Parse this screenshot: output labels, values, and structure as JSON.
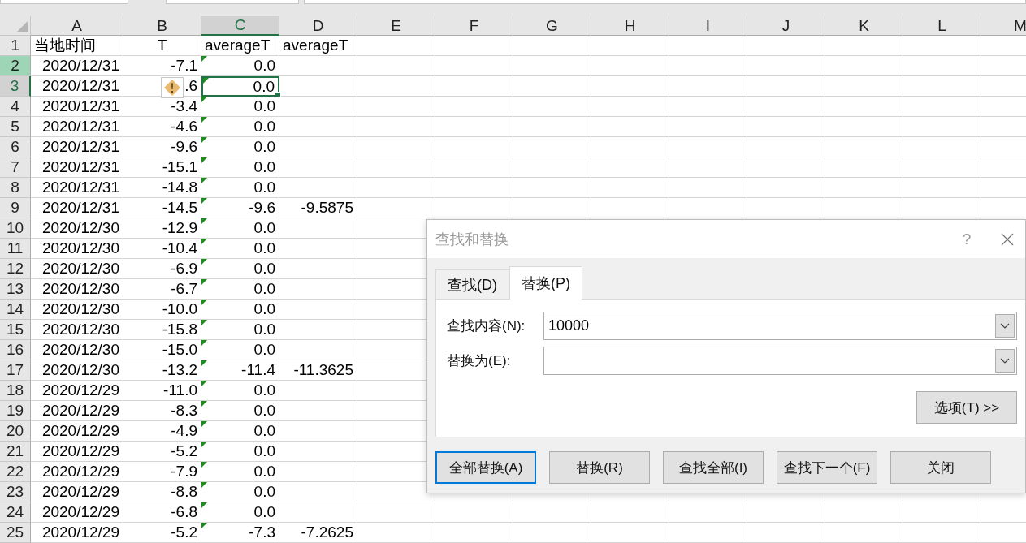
{
  "columns": [
    {
      "label": "A",
      "selected": false
    },
    {
      "label": "B",
      "selected": false
    },
    {
      "label": "C",
      "selected": true
    },
    {
      "label": "D",
      "selected": false
    },
    {
      "label": "E",
      "selected": false
    },
    {
      "label": "F",
      "selected": false
    },
    {
      "label": "G",
      "selected": false
    },
    {
      "label": "H",
      "selected": false
    },
    {
      "label": "I",
      "selected": false
    },
    {
      "label": "J",
      "selected": false
    },
    {
      "label": "K",
      "selected": false
    },
    {
      "label": "L",
      "selected": false
    },
    {
      "label": "M",
      "selected": false
    }
  ],
  "rows": [
    {
      "num": "1",
      "selected": false,
      "highlighted": false,
      "cells": [
        "当地时间",
        "T",
        "averageT",
        "averageT"
      ],
      "flag": false
    },
    {
      "num": "2",
      "selected": false,
      "highlighted": true,
      "cells": [
        "2020/12/31",
        "-7.1",
        "0.0",
        ""
      ],
      "flag": true
    },
    {
      "num": "3",
      "selected": true,
      "highlighted": false,
      "cells": [
        "2020/12/31",
        ".6",
        "0.0",
        ""
      ],
      "flag": true,
      "warning": true
    },
    {
      "num": "4",
      "selected": false,
      "highlighted": false,
      "cells": [
        "2020/12/31",
        "-3.4",
        "0.0",
        ""
      ],
      "flag": true
    },
    {
      "num": "5",
      "selected": false,
      "highlighted": false,
      "cells": [
        "2020/12/31",
        "-4.6",
        "0.0",
        ""
      ],
      "flag": true
    },
    {
      "num": "6",
      "selected": false,
      "highlighted": false,
      "cells": [
        "2020/12/31",
        "-9.6",
        "0.0",
        ""
      ],
      "flag": true
    },
    {
      "num": "7",
      "selected": false,
      "highlighted": false,
      "cells": [
        "2020/12/31",
        "-15.1",
        "0.0",
        ""
      ],
      "flag": true
    },
    {
      "num": "8",
      "selected": false,
      "highlighted": false,
      "cells": [
        "2020/12/31",
        "-14.8",
        "0.0",
        ""
      ],
      "flag": true
    },
    {
      "num": "9",
      "selected": false,
      "highlighted": false,
      "cells": [
        "2020/12/31",
        "-14.5",
        "-9.6",
        "-9.5875"
      ],
      "flag": true
    },
    {
      "num": "10",
      "selected": false,
      "highlighted": false,
      "cells": [
        "2020/12/30",
        "-12.9",
        "0.0",
        ""
      ],
      "flag": true
    },
    {
      "num": "11",
      "selected": false,
      "highlighted": false,
      "cells": [
        "2020/12/30",
        "-10.4",
        "0.0",
        ""
      ],
      "flag": true
    },
    {
      "num": "12",
      "selected": false,
      "highlighted": false,
      "cells": [
        "2020/12/30",
        "-6.9",
        "0.0",
        ""
      ],
      "flag": true
    },
    {
      "num": "13",
      "selected": false,
      "highlighted": false,
      "cells": [
        "2020/12/30",
        "-6.7",
        "0.0",
        ""
      ],
      "flag": true
    },
    {
      "num": "14",
      "selected": false,
      "highlighted": false,
      "cells": [
        "2020/12/30",
        "-10.0",
        "0.0",
        ""
      ],
      "flag": true
    },
    {
      "num": "15",
      "selected": false,
      "highlighted": false,
      "cells": [
        "2020/12/30",
        "-15.8",
        "0.0",
        ""
      ],
      "flag": true
    },
    {
      "num": "16",
      "selected": false,
      "highlighted": false,
      "cells": [
        "2020/12/30",
        "-15.0",
        "0.0",
        ""
      ],
      "flag": true
    },
    {
      "num": "17",
      "selected": false,
      "highlighted": false,
      "cells": [
        "2020/12/30",
        "-13.2",
        "-11.4",
        "-11.3625"
      ],
      "flag": true
    },
    {
      "num": "18",
      "selected": false,
      "highlighted": false,
      "cells": [
        "2020/12/29",
        "-11.0",
        "0.0",
        ""
      ],
      "flag": true
    },
    {
      "num": "19",
      "selected": false,
      "highlighted": false,
      "cells": [
        "2020/12/29",
        "-8.3",
        "0.0",
        ""
      ],
      "flag": true
    },
    {
      "num": "20",
      "selected": false,
      "highlighted": false,
      "cells": [
        "2020/12/29",
        "-4.9",
        "0.0",
        ""
      ],
      "flag": true
    },
    {
      "num": "21",
      "selected": false,
      "highlighted": false,
      "cells": [
        "2020/12/29",
        "-5.2",
        "0.0",
        ""
      ],
      "flag": true
    },
    {
      "num": "22",
      "selected": false,
      "highlighted": false,
      "cells": [
        "2020/12/29",
        "-7.9",
        "0.0",
        ""
      ],
      "flag": true
    },
    {
      "num": "23",
      "selected": false,
      "highlighted": false,
      "cells": [
        "2020/12/29",
        "-8.8",
        "0.0",
        ""
      ],
      "flag": true
    },
    {
      "num": "24",
      "selected": false,
      "highlighted": false,
      "cells": [
        "2020/12/29",
        "-6.8",
        "0.0",
        ""
      ],
      "flag": true
    },
    {
      "num": "25",
      "selected": false,
      "highlighted": false,
      "cells": [
        "2020/12/29",
        "-5.2",
        "-7.3",
        "-7.2625"
      ],
      "flag": true
    }
  ],
  "dialog": {
    "title": "查找和替换",
    "help": "?",
    "tabs": [
      {
        "label": "查找(D)",
        "selected": false
      },
      {
        "label": "替换(P)",
        "selected": true
      }
    ],
    "fields": [
      {
        "label": "查找内容(N):",
        "value": "10000"
      },
      {
        "label": "替换为(E):"
      }
    ],
    "options_button": "选项(T) >>",
    "buttons": [
      {
        "label": "全部替换(A)",
        "focused": true
      },
      {
        "label": "替换(R)",
        "focused": false
      },
      {
        "label": "查找全部(I)",
        "focused": false
      },
      {
        "label": "查找下一个(F)",
        "focused": false
      },
      {
        "label": "关闭",
        "focused": false
      }
    ]
  }
}
